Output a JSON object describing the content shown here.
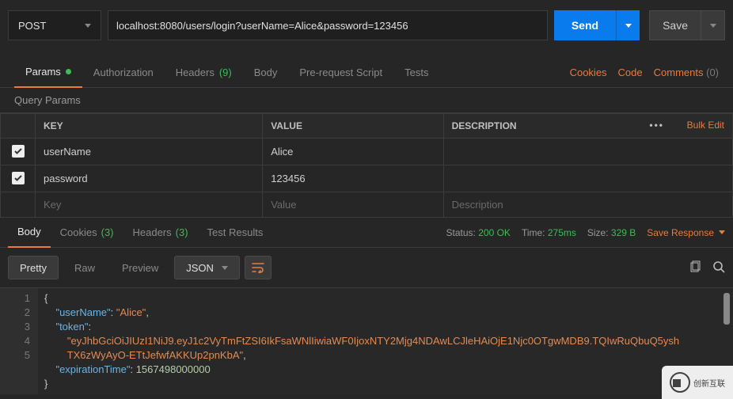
{
  "request": {
    "method": "POST",
    "url": "localhost:8080/users/login?userName=Alice&password=123456",
    "send_label": "Send",
    "save_label": "Save"
  },
  "tabs": {
    "params": "Params",
    "authorization": "Authorization",
    "headers": "Headers",
    "headers_count": "(9)",
    "body": "Body",
    "prerequest": "Pre-request Script",
    "tests": "Tests",
    "cookies": "Cookies",
    "code": "Code",
    "comments": "Comments",
    "comments_count": "(0)"
  },
  "query_params": {
    "title": "Query Params",
    "keyHeader": "KEY",
    "valueHeader": "VALUE",
    "descHeader": "DESCRIPTION",
    "bulk": "Bulk Edit",
    "rows": [
      {
        "checked": true,
        "key": "userName",
        "value": "Alice",
        "desc": ""
      },
      {
        "checked": true,
        "key": "password",
        "value": "123456",
        "desc": ""
      }
    ],
    "placeholders": {
      "key": "Key",
      "value": "Value",
      "desc": "Description"
    }
  },
  "response": {
    "tabs": {
      "body": "Body",
      "cookies": "Cookies",
      "cookies_count": "(3)",
      "headers": "Headers",
      "headers_count": "(3)",
      "test_results": "Test Results"
    },
    "status_label": "Status:",
    "status_value": "200 OK",
    "time_label": "Time:",
    "time_value": "275ms",
    "size_label": "Size:",
    "size_value": "329 B",
    "save_response": "Save Response"
  },
  "body_toolbar": {
    "pretty": "Pretty",
    "raw": "Raw",
    "preview": "Preview",
    "format": "JSON"
  },
  "response_body": {
    "lines": [
      "1",
      "2",
      "3",
      "",
      "",
      "4",
      "5"
    ],
    "json": {
      "userName": "Alice",
      "token": "eyJhbGciOiJIUzI1NiJ9.eyJ1c2VyTmFtZSI6IkFsaWNlIiwiaWF0IjoxNTY2Mjg4NDAwLCJleHAiOjE1Njc0OTgwMDB9.TQIwRuQbuQ5yshTX6zWyAyO-ETtJefwfAKKUp2pnKbA",
      "expirationTime": 1567498000000
    }
  },
  "watermark": "创新互联"
}
